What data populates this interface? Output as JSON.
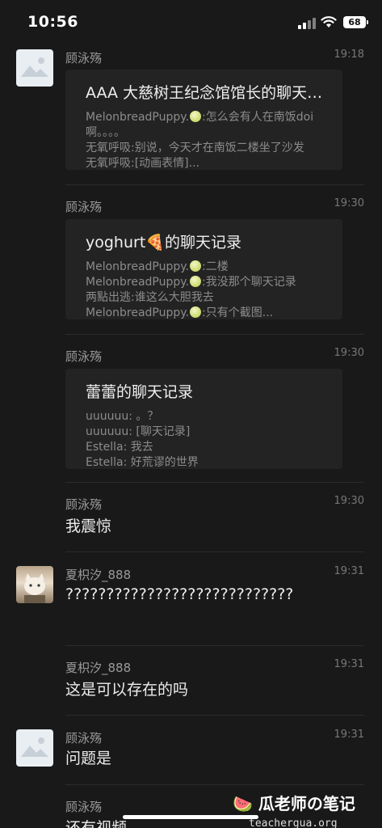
{
  "status_bar": {
    "time": "10:56",
    "battery": "68"
  },
  "messages": [
    {
      "sender": "顾泳殇",
      "time": "19:18",
      "card": {
        "title": "AAA 大慈树王纪念馆馆长的聊天记录",
        "lines": [
          "MelonbreadPuppy.",
          ":怎么会有人在南饭doi",
          "啊。。。。",
          "无氧呼吸:别说，今天才在南饭二楼坐了沙发",
          "无氧呼吸:[动画表情]..."
        ]
      }
    },
    {
      "sender": "顾泳殇",
      "time": "19:30",
      "card": {
        "title_prefix": "yoghurt",
        "title_suffix": "的聊天记录",
        "lines": [
          "MelonbreadPuppy.",
          ":二楼",
          "MelonbreadPuppy.",
          ":我没那个聊天记录",
          "两點出逃:谁这么大胆我去",
          "MelonbreadPuppy.",
          ":只有个截图..."
        ]
      }
    },
    {
      "sender": "顾泳殇",
      "time": "19:30",
      "card": {
        "title": "蕾蕾的聊天记录",
        "lines": [
          "uuuuuu: 。？",
          "uuuuuu: [聊天记录]",
          "Estella: 我去",
          "Estella: 好荒谬的世界"
        ]
      }
    },
    {
      "sender": "顾泳殇",
      "time": "19:30",
      "text": "我震惊"
    },
    {
      "sender": "夏枳汐_888",
      "time": "19:31",
      "text": "????????????????????????????"
    },
    {
      "sender": "夏枳汐_888",
      "time": "19:31",
      "text": "这是可以存在的吗"
    },
    {
      "sender": "顾泳殇",
      "time": "19:31",
      "text": "问题是"
    },
    {
      "sender": "顾泳殇",
      "text": "还有视频"
    }
  ],
  "watermark": {
    "title": "瓜老师の笔记",
    "subtitle": "teachergua.org"
  }
}
